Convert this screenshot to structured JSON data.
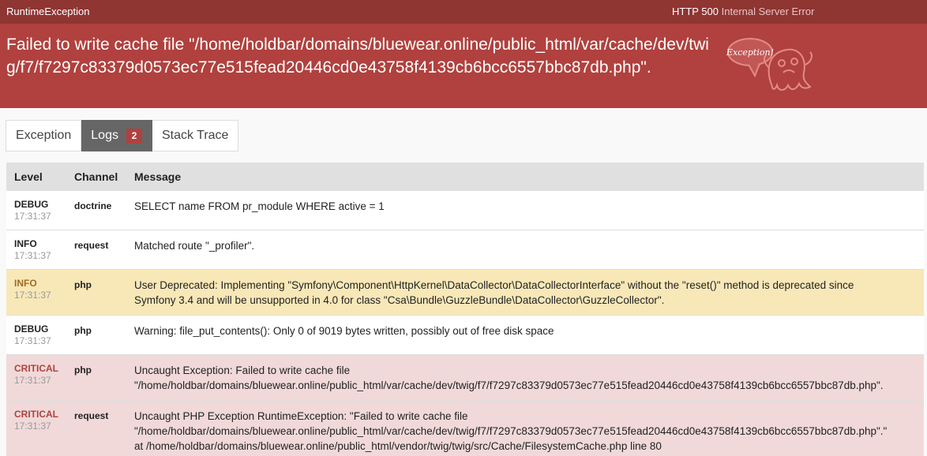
{
  "header": {
    "exception_class": "RuntimeException",
    "status_code": "HTTP 500",
    "status_text": "Internal Server Error"
  },
  "exception": {
    "message": "Failed to write cache file \"/home/holdbar/domains/bluewear.online/public_html/var/cache/dev/twig/f7/f7297c83379d0573ec77e515fead20446cd0e43758f4139cb6bcc6557bbc87db.php\".",
    "mascot_label": "Exception!"
  },
  "tabs": [
    {
      "label": "Exception"
    },
    {
      "label": "Logs",
      "badge": "2"
    },
    {
      "label": "Stack Trace"
    }
  ],
  "logs": {
    "columns": [
      "Level",
      "Channel",
      "Message"
    ],
    "rows": [
      {
        "level": "DEBUG",
        "time": "17:31:37",
        "channel": "doctrine",
        "lines": [
          "SELECT name FROM pr_module WHERE active = 1"
        ]
      },
      {
        "level": "INFO",
        "time": "17:31:37",
        "channel": "request",
        "lines": [
          "Matched route \"_profiler\"."
        ]
      },
      {
        "level": "INFO",
        "time": "17:31:37",
        "channel": "php",
        "lines": [
          "User Deprecated: Implementing \"Symfony\\Component\\HttpKernel\\DataCollector\\DataCollectorInterface\" without the \"reset()\" method is deprecated since",
          "Symfony 3.4 and will be unsupported in 4.0 for class \"Csa\\Bundle\\GuzzleBundle\\DataCollector\\GuzzleCollector\"."
        ]
      },
      {
        "level": "DEBUG",
        "time": "17:31:37",
        "channel": "php",
        "lines": [
          "Warning: file_put_contents(): Only 0 of 9019 bytes written, possibly out of free disk space"
        ]
      },
      {
        "level": "CRITICAL",
        "time": "17:31:37",
        "channel": "php",
        "lines": [
          "Uncaught Exception: Failed to write cache file",
          "\"/home/holdbar/domains/bluewear.online/public_html/var/cache/dev/twig/f7/f7297c83379d0573ec77e515fead20446cd0e43758f4139cb6bcc6557bbc87db.php\"."
        ]
      },
      {
        "level": "CRITICAL",
        "time": "17:31:37",
        "channel": "request",
        "lines": [
          "Uncaught PHP Exception RuntimeException: \"Failed to write cache file",
          "\"/home/holdbar/domains/bluewear.online/public_html/var/cache/dev/twig/f7/f7297c83379d0573ec77e515fead20446cd0e43758f4139cb6bcc6557bbc87db.php\".\"",
          "at /home/holdbar/domains/bluewear.online/public_html/vendor/twig/twig/src/Cache/FilesystemCache.php line 80"
        ]
      }
    ]
  }
}
